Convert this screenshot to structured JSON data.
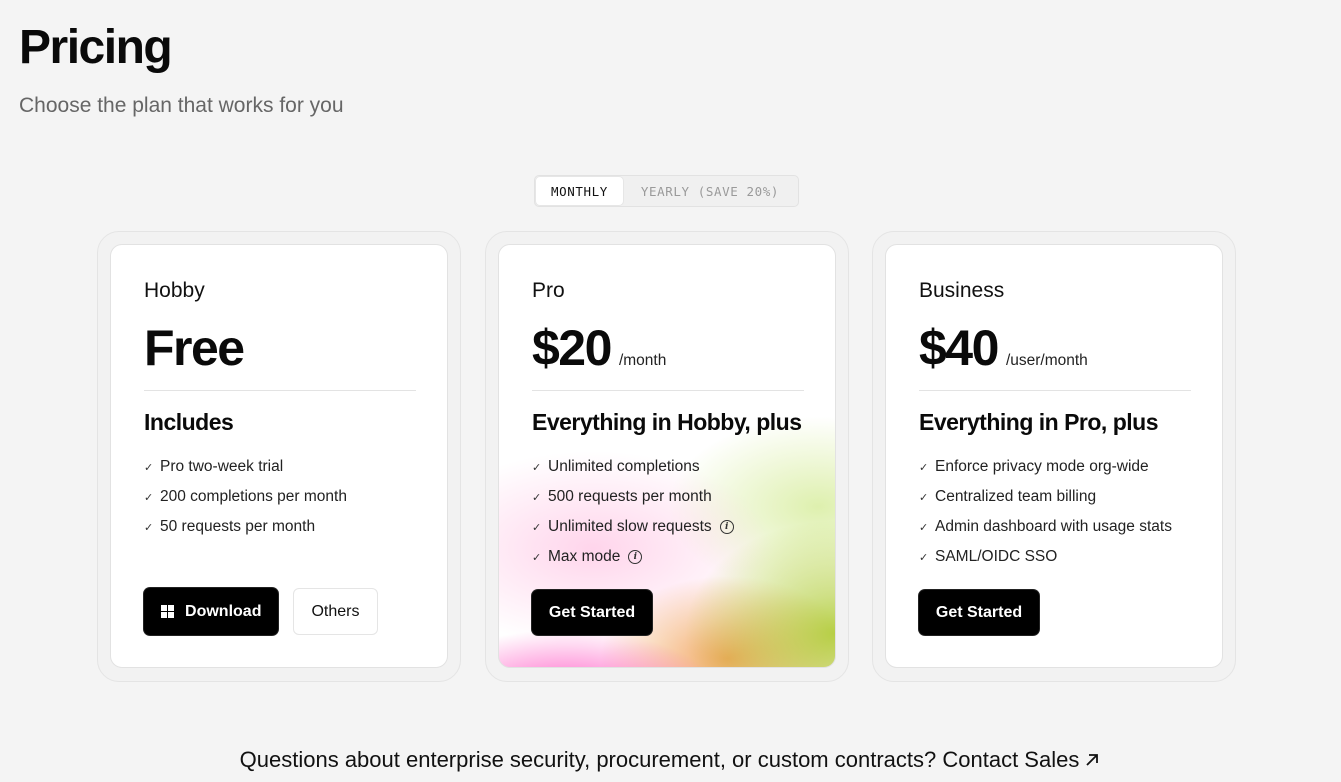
{
  "header": {
    "title": "Pricing",
    "subtitle": "Choose the plan that works for you"
  },
  "billing_toggle": {
    "monthly": "MONTHLY",
    "yearly": "YEARLY (SAVE 20%)",
    "selected": "monthly"
  },
  "plans": [
    {
      "name": "Hobby",
      "price": "Free",
      "unit": "",
      "includes_title": "Includes",
      "features": [
        {
          "text": "Pro two-week trial"
        },
        {
          "text": "200 completions per month"
        },
        {
          "text": "50 requests per month"
        }
      ],
      "primary_button": "Download",
      "secondary_button": "Others"
    },
    {
      "name": "Pro",
      "price": "$20",
      "unit": "/month",
      "includes_title": "Everything in Hobby, plus",
      "features": [
        {
          "text": "Unlimited completions"
        },
        {
          "text": "500 requests per month"
        },
        {
          "text": "Unlimited slow requests",
          "info": true
        },
        {
          "text": "Max mode",
          "info": true
        }
      ],
      "primary_button": "Get Started"
    },
    {
      "name": "Business",
      "price": "$40",
      "unit": "/user/month",
      "includes_title": "Everything in Pro, plus",
      "features": [
        {
          "text": "Enforce privacy mode org-wide"
        },
        {
          "text": "Centralized team billing"
        },
        {
          "text": "Admin dashboard with usage stats"
        },
        {
          "text": "SAML/OIDC SSO"
        }
      ],
      "primary_button": "Get Started"
    }
  ],
  "footer": {
    "text": "Questions about enterprise security, procurement, or custom contracts?",
    "link": "Contact Sales"
  },
  "colors": {
    "background": "#f4f4f4",
    "button_dark": "#000000",
    "text_muted": "#666666"
  },
  "icons": {
    "check": "check-icon",
    "info": "info-circle-icon",
    "windows": "windows-icon",
    "arrow": "arrow-up-right-icon"
  }
}
